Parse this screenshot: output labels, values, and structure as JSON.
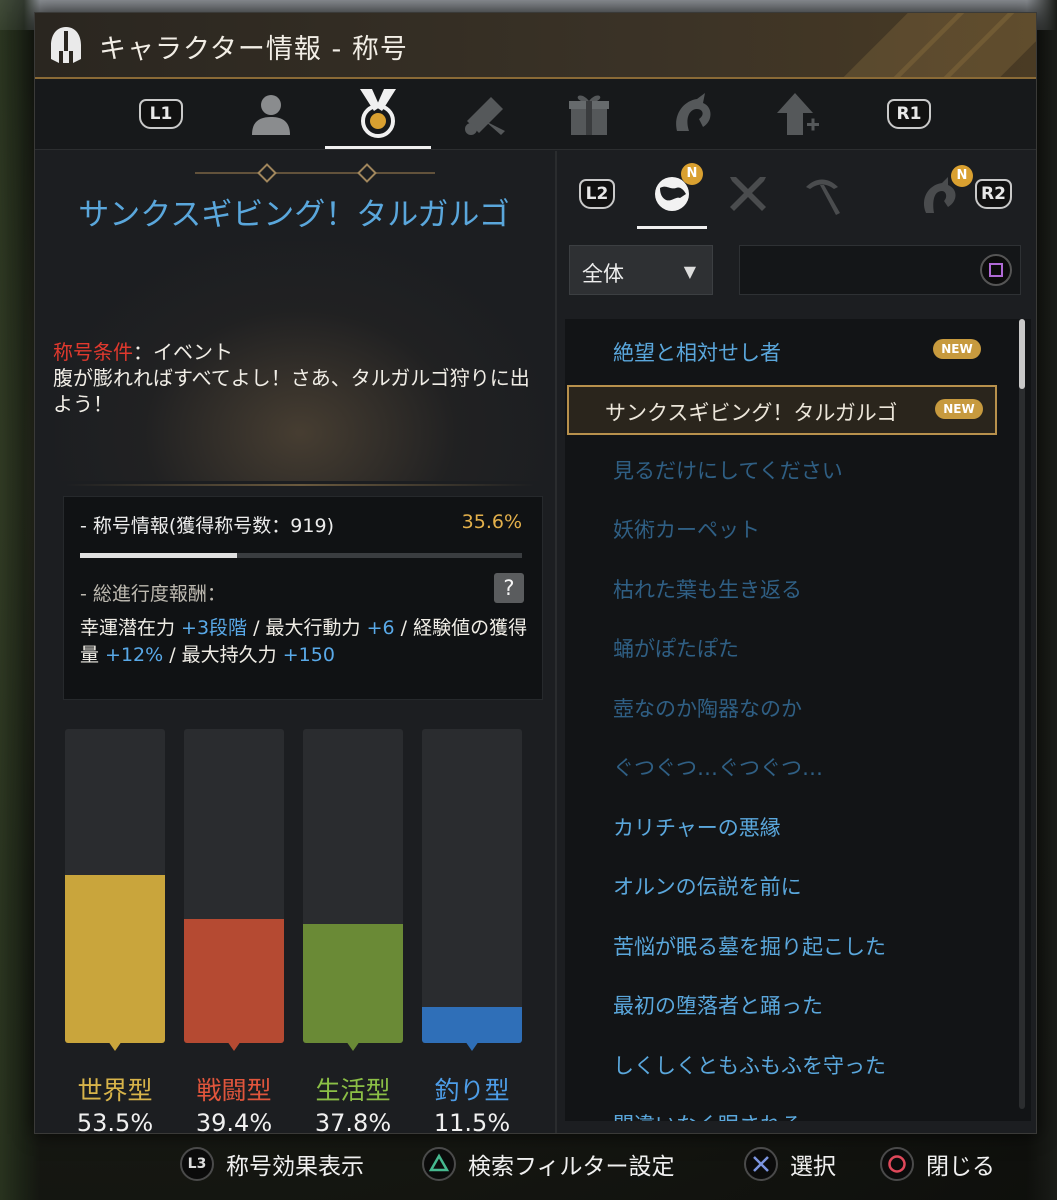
{
  "window": {
    "title": "キャラクター情報 - 称号"
  },
  "main_tabs": {
    "left_button": "L1",
    "right_button": "R1",
    "active_tab": "title-medal"
  },
  "detail": {
    "title_name": "サンクスギビング！タルガルゴ",
    "condition_label": "称号条件",
    "condition_value": "：イベント",
    "description": "腹が膨れればすべてよし！さあ、タルガルゴ狩りに出よう！"
  },
  "info": {
    "header": "- 称号情報(獲得称号数：919)",
    "percent": "35.6%",
    "progress": 0.356,
    "reward_label": "- 総進行度報酬：",
    "help_label": "?",
    "rewards": [
      {
        "text": "幸運潜在力 ",
        "value": "+3段階"
      },
      {
        "text": " / 最大行動力 ",
        "value": "+6"
      },
      {
        "text": " / 経験値の獲得量 ",
        "value": "+12%"
      },
      {
        "text": " / 最大持久力 ",
        "value": "+150"
      }
    ]
  },
  "categories": [
    {
      "name": "世界型",
      "percent": "53.5%",
      "value": 0.535,
      "color": "#c9a53c",
      "name_color": "#d8b44a"
    },
    {
      "name": "戦闘型",
      "percent": "39.4%",
      "value": 0.394,
      "color": "#b54a32",
      "name_color": "#e0553c"
    },
    {
      "name": "生活型",
      "percent": "37.8%",
      "value": 0.378,
      "color": "#6a8a36",
      "name_color": "#8bbf46"
    },
    {
      "name": "釣り型",
      "percent": "11.5%",
      "value": 0.115,
      "color": "#2f6fb8",
      "name_color": "#4d9de8"
    }
  ],
  "sub_tabs": {
    "left_button": "L2",
    "right_button": "R2",
    "new_badge": "N"
  },
  "filter": {
    "dropdown_value": "全体",
    "dropdown_arrow": "▼",
    "search_value": ""
  },
  "title_list": {
    "new_label": "NEW",
    "items": [
      {
        "label": "絶望と相対せし者",
        "new": true,
        "selected": false,
        "color": "#5aa7dc"
      },
      {
        "label": "サンクスギビング！タルガルゴ",
        "new": true,
        "selected": true,
        "color": "#ece6da"
      },
      {
        "label": "見るだけにしてください",
        "new": false,
        "selected": false,
        "color": "#2f5f84"
      },
      {
        "label": "妖術カーペット",
        "new": false,
        "selected": false,
        "color": "#2f5f84"
      },
      {
        "label": "枯れた葉も生き返る",
        "new": false,
        "selected": false,
        "color": "#2f5f84"
      },
      {
        "label": "蛹がぽたぽた",
        "new": false,
        "selected": false,
        "color": "#2f5f84"
      },
      {
        "label": "壺なのか陶器なのか",
        "new": false,
        "selected": false,
        "color": "#2f5f84"
      },
      {
        "label": "ぐつぐつ…ぐつぐつ…",
        "new": false,
        "selected": false,
        "color": "#2f5f84"
      },
      {
        "label": "カリチャーの悪縁",
        "new": false,
        "selected": false,
        "color": "#5aa7dc"
      },
      {
        "label": "オルンの伝説を前に",
        "new": false,
        "selected": false,
        "color": "#5aa7dc"
      },
      {
        "label": "苦悩が眠る墓を掘り起こした",
        "new": false,
        "selected": false,
        "color": "#5aa7dc"
      },
      {
        "label": "最初の堕落者と踊った",
        "new": false,
        "selected": false,
        "color": "#5aa7dc"
      },
      {
        "label": "しくしくともふもふを守った",
        "new": false,
        "selected": false,
        "color": "#5aa7dc"
      },
      {
        "label": "間違いなく眠される",
        "new": false,
        "selected": false,
        "color": "#5aa7dc"
      }
    ]
  },
  "bottom_bar": {
    "items": [
      {
        "button": "L3",
        "icon": "l3-button-icon",
        "label": "称号効果表示"
      },
      {
        "button": "triangle",
        "icon": "triangle-button-icon",
        "label": "検索フィルター設定"
      },
      {
        "button": "cross",
        "icon": "cross-button-icon",
        "label": "選択"
      },
      {
        "button": "circle",
        "icon": "circle-button-icon",
        "label": "閉じる"
      }
    ]
  }
}
